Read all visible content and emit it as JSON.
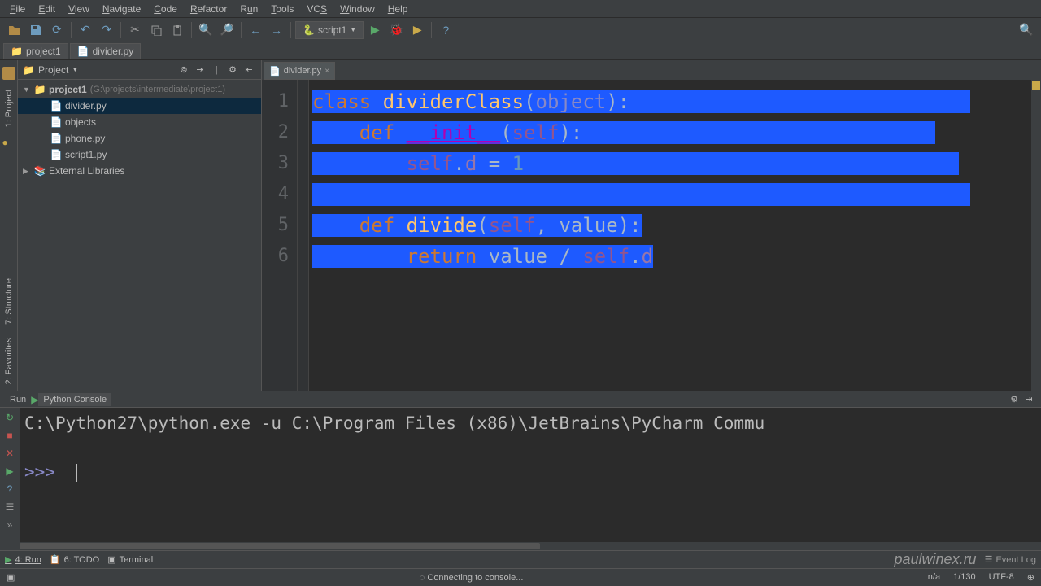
{
  "menubar": {
    "items": [
      {
        "label": "File",
        "key": "F"
      },
      {
        "label": "Edit",
        "key": "E"
      },
      {
        "label": "View",
        "key": "V"
      },
      {
        "label": "Navigate",
        "key": "N"
      },
      {
        "label": "Code",
        "key": "C"
      },
      {
        "label": "Refactor",
        "key": "R"
      },
      {
        "label": "Run",
        "key": "u"
      },
      {
        "label": "Tools",
        "key": "T"
      },
      {
        "label": "VCS",
        "key": "S"
      },
      {
        "label": "Window",
        "key": "W"
      },
      {
        "label": "Help",
        "key": "H"
      }
    ]
  },
  "toolbar": {
    "run_config": "script1"
  },
  "breadcrumb": {
    "project": "project1",
    "file": "divider.py"
  },
  "rail": {
    "project": "1: Project",
    "structure": "7: Structure",
    "favorites": "2: Favorites"
  },
  "project_panel": {
    "title": "Project",
    "tree": {
      "root": "project1",
      "root_path": "(G:\\projects\\intermediate\\project1)",
      "files": [
        "divider.py",
        "objects",
        "phone.py",
        "script1.py"
      ],
      "external": "External Libraries"
    }
  },
  "editor": {
    "tab": "divider.py",
    "lines": [
      "1",
      "2",
      "3",
      "4",
      "5",
      "6"
    ]
  },
  "code": {
    "l1": {
      "class": "class ",
      "name": "dividerClass",
      "lp": "(",
      "obj": "object",
      "rp": "):"
    },
    "l2": {
      "def": "def ",
      "fn": "__init__",
      "lp": "(",
      "self": "self",
      "rp": "):"
    },
    "l3": {
      "self": "self",
      "dot": ".",
      "attr": "d",
      "eq": " = ",
      "num": "1"
    },
    "l5": {
      "def": "def ",
      "fn": "divide",
      "lp": "(",
      "self": "self",
      "comma": ", ",
      "param": "value",
      "rp": "):"
    },
    "l6": {
      "ret": "return ",
      "val": "value",
      "op": " / ",
      "self": "self",
      "dot": ".",
      "attr": "d"
    }
  },
  "console": {
    "tab_run": "Run",
    "tab_console": "Python Console",
    "cmd": "C:\\Python27\\python.exe -u C:\\Program Files (x86)\\JetBrains\\PyCharm Commu",
    "prompt": ">>> "
  },
  "bottom_tabs": {
    "run": "4: Run",
    "todo": "6: TODO",
    "terminal": "Terminal",
    "event_log": "Event Log"
  },
  "watermark": "paulwinex.ru",
  "status": {
    "connecting": "Connecting to console...",
    "pos": "1/130",
    "na": "n/a",
    "encoding": "UTF-8",
    "insert": "⊕"
  }
}
